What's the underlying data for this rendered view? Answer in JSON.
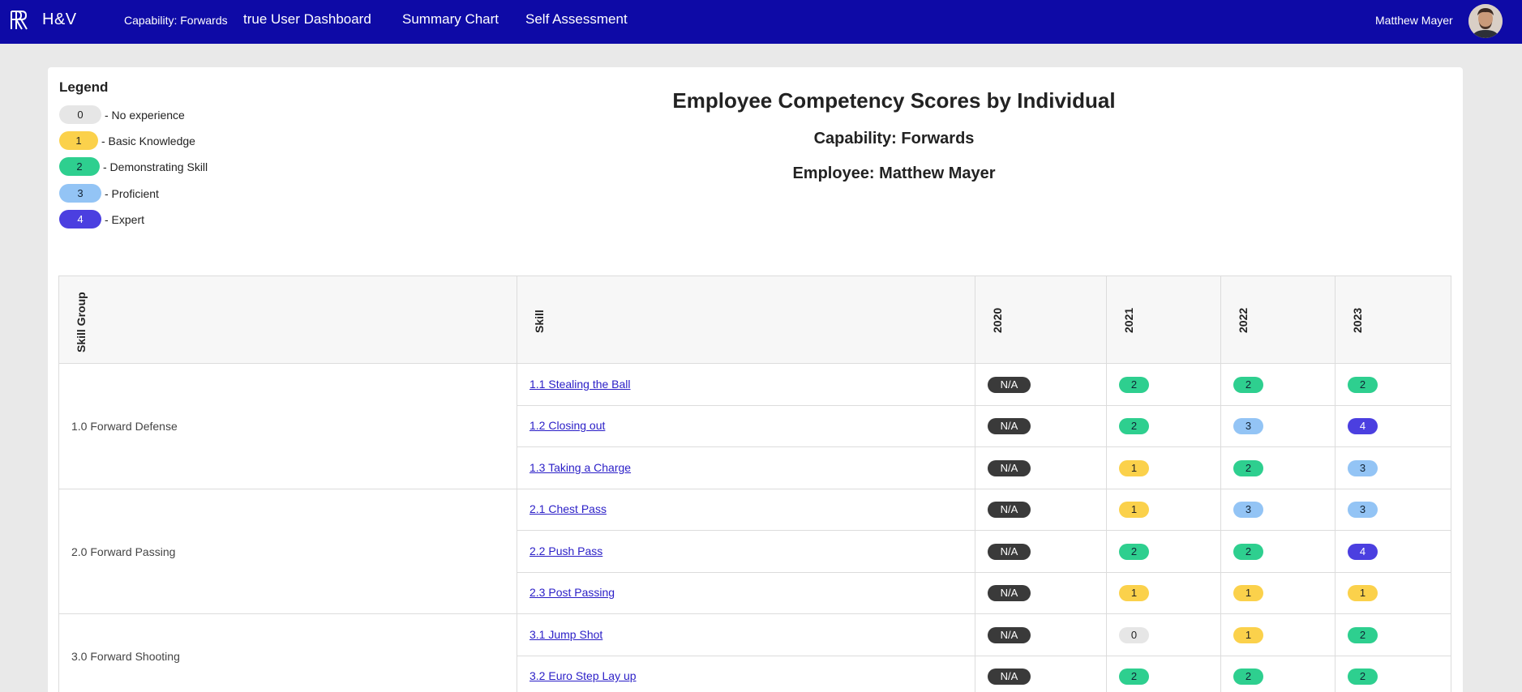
{
  "nav": {
    "brand": "H&V",
    "capability": "Capability: Forwards",
    "link_user_dashboard": "true User Dashboard",
    "link_summary_chart": "Summary Chart",
    "link_self_assessment": "Self Assessment",
    "user_name": "Matthew Mayer"
  },
  "legend": {
    "title": "Legend",
    "items": [
      {
        "score": "0",
        "label": "- No experience"
      },
      {
        "score": "1",
        "label": "- Basic Knowledge"
      },
      {
        "score": "2",
        "label": "- Demonstrating Skill"
      },
      {
        "score": "3",
        "label": "- Proficient"
      },
      {
        "score": "4",
        "label": "- Expert"
      }
    ]
  },
  "report": {
    "title": "Employee Competency Scores by Individual",
    "capability": "Capability: Forwards",
    "employee": "Employee: Matthew Mayer"
  },
  "table": {
    "headers": {
      "group": "Skill Group",
      "skill": "Skill",
      "years": [
        "2020",
        "2021",
        "2022",
        "2023"
      ]
    },
    "groups": [
      {
        "name": "1.0 Forward Defense",
        "skills": [
          {
            "name": "1.1 Stealing the Ball",
            "scores": [
              "N/A",
              "2",
              "2",
              "2"
            ]
          },
          {
            "name": "1.2 Closing out",
            "scores": [
              "N/A",
              "2",
              "3",
              "4"
            ]
          },
          {
            "name": "1.3 Taking a Charge",
            "scores": [
              "N/A",
              "1",
              "2",
              "3"
            ]
          }
        ]
      },
      {
        "name": "2.0 Forward Passing",
        "skills": [
          {
            "name": "2.1 Chest Pass",
            "scores": [
              "N/A",
              "1",
              "3",
              "3"
            ]
          },
          {
            "name": "2.2 Push Pass",
            "scores": [
              "N/A",
              "2",
              "2",
              "4"
            ]
          },
          {
            "name": "2.3 Post Passing",
            "scores": [
              "N/A",
              "1",
              "1",
              "1"
            ]
          }
        ]
      },
      {
        "name": "3.0 Forward Shooting",
        "skills": [
          {
            "name": "3.1 Jump Shot",
            "scores": [
              "N/A",
              "0",
              "1",
              "2"
            ]
          },
          {
            "name": "3.2 Euro Step Lay up",
            "scores": [
              "N/A",
              "2",
              "2",
              "2"
            ]
          }
        ]
      }
    ]
  },
  "colors": {
    "nav_bg": "#0e0aa6",
    "score_0": "#e6e6e6",
    "score_1": "#fbd14b",
    "score_2": "#2ecf8f",
    "score_3": "#93c4f5",
    "score_4": "#4b3fe0",
    "na": "#3a3a3a"
  }
}
